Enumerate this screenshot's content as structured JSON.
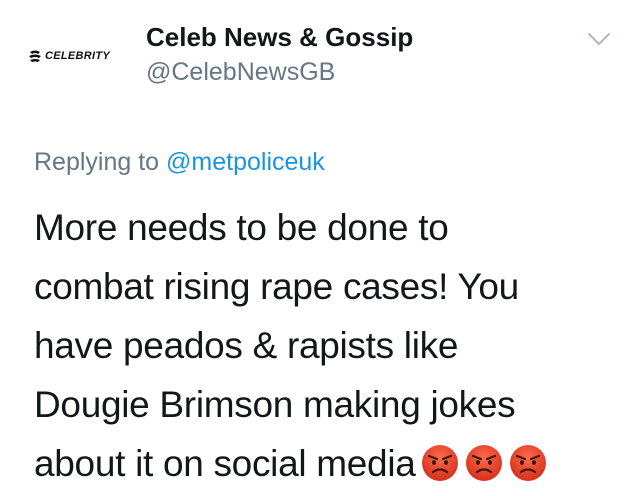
{
  "account": {
    "display_name": "Celeb News & Gossip",
    "handle": "@CelebNewsGB",
    "avatar_text": "CELEBRITY"
  },
  "reply": {
    "prefix": "Replying to",
    "mention": "@metpoliceuk"
  },
  "tweet": {
    "lines": [
      "More needs to be done to",
      "combat rising rape cases! You",
      "have peados & rapists like",
      "Dougie Brimson making jokes",
      "about it on social media"
    ],
    "emoji": [
      "angry-face",
      "angry-face",
      "angry-face"
    ]
  },
  "menu": {
    "icon": "chevron-down-icon"
  },
  "colors": {
    "text": "#14171a",
    "secondary": "#657786",
    "link": "#1b95e0",
    "emoji_red": "#e2452c"
  }
}
